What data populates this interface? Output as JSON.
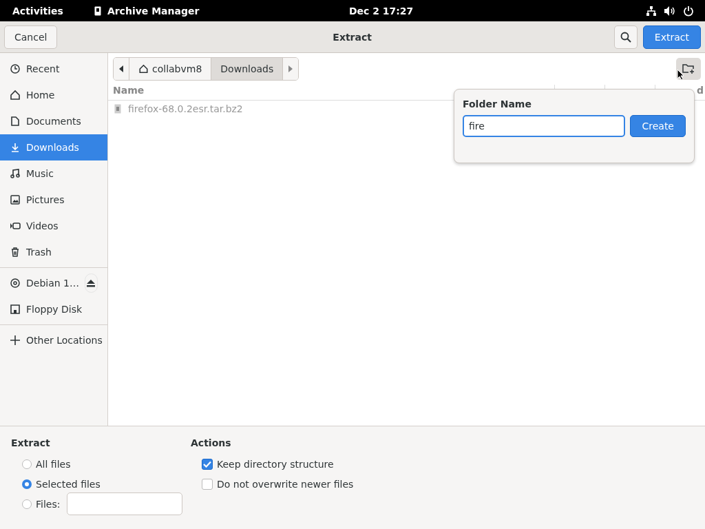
{
  "top_bar": {
    "activities": "Activities",
    "app_name": "Archive Manager",
    "clock": "Dec 2  17:27"
  },
  "header": {
    "cancel": "Cancel",
    "title": "Extract",
    "extract": "Extract"
  },
  "sidebar": {
    "groups": [
      [
        {
          "label": "Recent",
          "selected": false
        },
        {
          "label": "Home",
          "selected": false
        },
        {
          "label": "Documents",
          "selected": false
        },
        {
          "label": "Downloads",
          "selected": true
        },
        {
          "label": "Music",
          "selected": false
        },
        {
          "label": "Pictures",
          "selected": false
        },
        {
          "label": "Videos",
          "selected": false
        },
        {
          "label": "Trash",
          "selected": false
        }
      ],
      [
        {
          "label": "Debian 1…",
          "selected": false,
          "eject": true
        },
        {
          "label": "Floppy Disk",
          "selected": false,
          "eject": false
        }
      ],
      [
        {
          "label": "Other Locations",
          "selected": false
        }
      ]
    ]
  },
  "path_bar": [
    {
      "label": "collabvm8",
      "selected": false
    },
    {
      "label": "Downloads",
      "selected": true
    }
  ],
  "table": {
    "columns": [
      "Name",
      "d"
    ],
    "rows": [
      {
        "name": "firefox-68.0.2esr.tar.bz2"
      }
    ]
  },
  "popover": {
    "label": "Folder Name",
    "value": "fire",
    "button": "Create"
  },
  "options": {
    "extract_title": "Extract",
    "radios": [
      {
        "label": "All files",
        "selected": false
      },
      {
        "label": "Selected files",
        "selected": true
      },
      {
        "label": "Files:",
        "selected": false,
        "field": true
      }
    ],
    "actions_title": "Actions",
    "checks": [
      {
        "label": "Keep directory structure",
        "checked": true
      },
      {
        "label": "Do not overwrite newer files",
        "checked": false
      }
    ]
  }
}
